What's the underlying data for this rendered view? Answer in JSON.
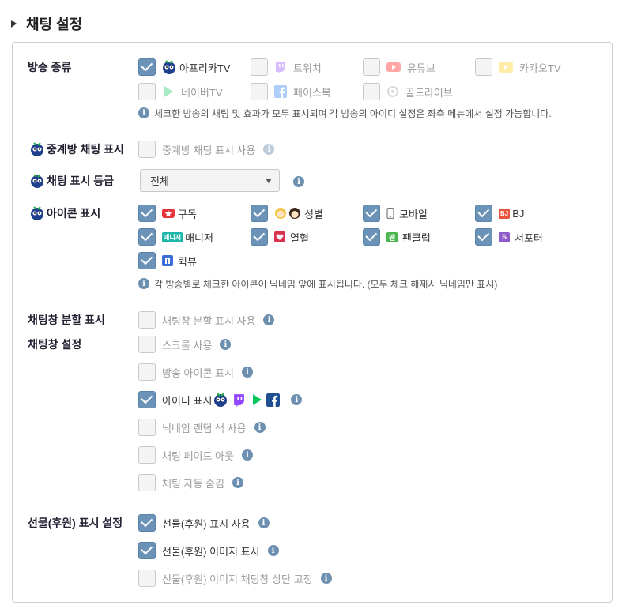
{
  "section": {
    "title": "채팅 설정"
  },
  "broadcast": {
    "label": "방송 종류",
    "options": [
      {
        "label": "아프리카TV",
        "checked": true,
        "icon": "afreecatv-icon"
      },
      {
        "label": "트위치",
        "checked": false,
        "icon": "twitch-icon"
      },
      {
        "label": "유튜브",
        "checked": false,
        "icon": "youtube-icon"
      },
      {
        "label": "카카오TV",
        "checked": false,
        "icon": "kakaotv-icon"
      },
      {
        "label": "네이버TV",
        "checked": false,
        "icon": "navertv-icon"
      },
      {
        "label": "페이스북",
        "checked": false,
        "icon": "facebook-icon"
      },
      {
        "label": "골드라이브",
        "checked": false,
        "icon": "goldlive-icon"
      }
    ],
    "note": "체크한 방송의 채팅 및 효과가 모두 표시되며 각 방송의 아이디 설정은 좌측 메뉴에서 설정 가능합니다."
  },
  "relay": {
    "label": "중계방 채팅 표시",
    "option": "중계방 채팅 표시 사용",
    "checked": false
  },
  "grade": {
    "label": "채팅 표시 등급",
    "value": "전체"
  },
  "icons": {
    "label": "아이콘 표시",
    "options": [
      {
        "label": "구독",
        "checked": true,
        "icon": "subscribe-icon"
      },
      {
        "label": "성별",
        "checked": true,
        "icon": "gender-icon"
      },
      {
        "label": "모바일",
        "checked": true,
        "icon": "mobile-icon"
      },
      {
        "label": "BJ",
        "checked": true,
        "icon": "bj-badge-icon",
        "badge": "BJ"
      },
      {
        "label": "매니저",
        "checked": true,
        "icon": "manager-badge-icon",
        "badge": "매니저"
      },
      {
        "label": "열혈",
        "checked": true,
        "icon": "hot-fan-icon"
      },
      {
        "label": "팬클럽",
        "checked": true,
        "icon": "fanclub-icon",
        "badge": "팬"
      },
      {
        "label": "서포터",
        "checked": true,
        "icon": "supporter-icon",
        "badge": "S"
      },
      {
        "label": "퀵뷰",
        "checked": true,
        "icon": "quickview-icon"
      }
    ],
    "note": "각 방송별로 체크한 아이콘이 닉네임 앞에 표시됩니다. (모두 체크 해제시 닉네임만 표시)"
  },
  "split": {
    "label": "채팅창 분할 표시",
    "option": "채팅창 분할 표시 사용",
    "checked": false
  },
  "window": {
    "label": "채팅창 설정",
    "options": [
      {
        "label": "스크롤 사용",
        "checked": false
      },
      {
        "label": "방송 아이콘 표시",
        "checked": false
      },
      {
        "label": "아이디 표시",
        "checked": true
      },
      {
        "label": "닉네임 랜덤 색 사용",
        "checked": false
      },
      {
        "label": "채팅 페이드 아웃",
        "checked": false
      },
      {
        "label": "채팅 자동 숨김",
        "checked": false
      }
    ]
  },
  "gift": {
    "label": "선물(후원) 표시 설정",
    "options": [
      {
        "label": "선물(후원) 표시 사용",
        "checked": true
      },
      {
        "label": "선물(후원) 이미지 표시",
        "checked": true
      },
      {
        "label": "선물(후원) 이미지 채팅창 상단 고정",
        "checked": false
      }
    ]
  },
  "colors": {
    "checkbox_checked": "#6b93b8",
    "info": "#6d8fb0",
    "panel_border": "#cfcfcf"
  }
}
